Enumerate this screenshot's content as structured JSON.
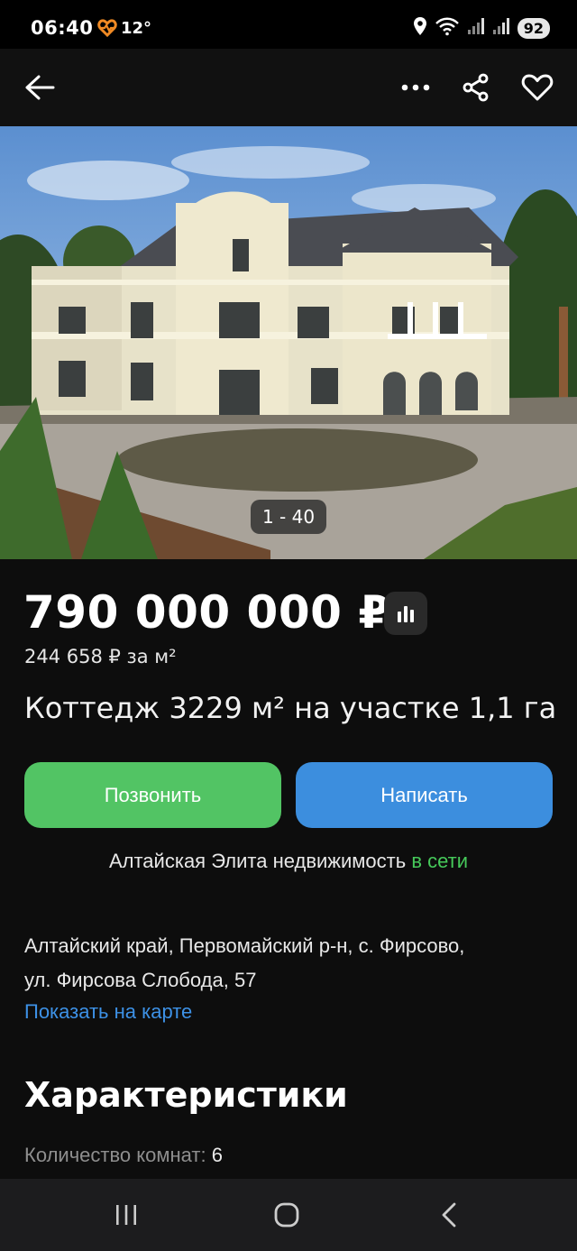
{
  "status_bar": {
    "time": "06:40",
    "temperature": "12°",
    "battery": "92",
    "icons": [
      "heart-rate-icon",
      "location-icon",
      "wifi-icon",
      "signal-icon",
      "signal-icon"
    ]
  },
  "app_bar": {
    "icons": [
      "back-arrow-icon",
      "more-icon",
      "share-icon",
      "favorite-icon"
    ]
  },
  "gallery": {
    "counter": "1 - 40"
  },
  "listing": {
    "price": "790 000 000 ₽",
    "price_per_m2": "244 658 ₽ за м²",
    "title": "Коттедж 3229 м² на участке 1,1 га"
  },
  "actions": {
    "call_label": "Позвонить",
    "write_label": "Написать"
  },
  "seller": {
    "name": "Алтайская Элита недвижимость",
    "status": "в сети"
  },
  "address": {
    "line1": "Алтайский край, Первомайский р-н, с. Фирсово,",
    "line2": "ул. Фирсова Слобода, 57",
    "map_link": "Показать на карте"
  },
  "characteristics": {
    "heading": "Характеристики",
    "rows": [
      {
        "label": "Количество комнат: ",
        "value": "6"
      }
    ]
  },
  "colors": {
    "call_button": "#52c464",
    "write_button": "#3c8ede",
    "online": "#46c95a",
    "link": "#3d91e6"
  }
}
